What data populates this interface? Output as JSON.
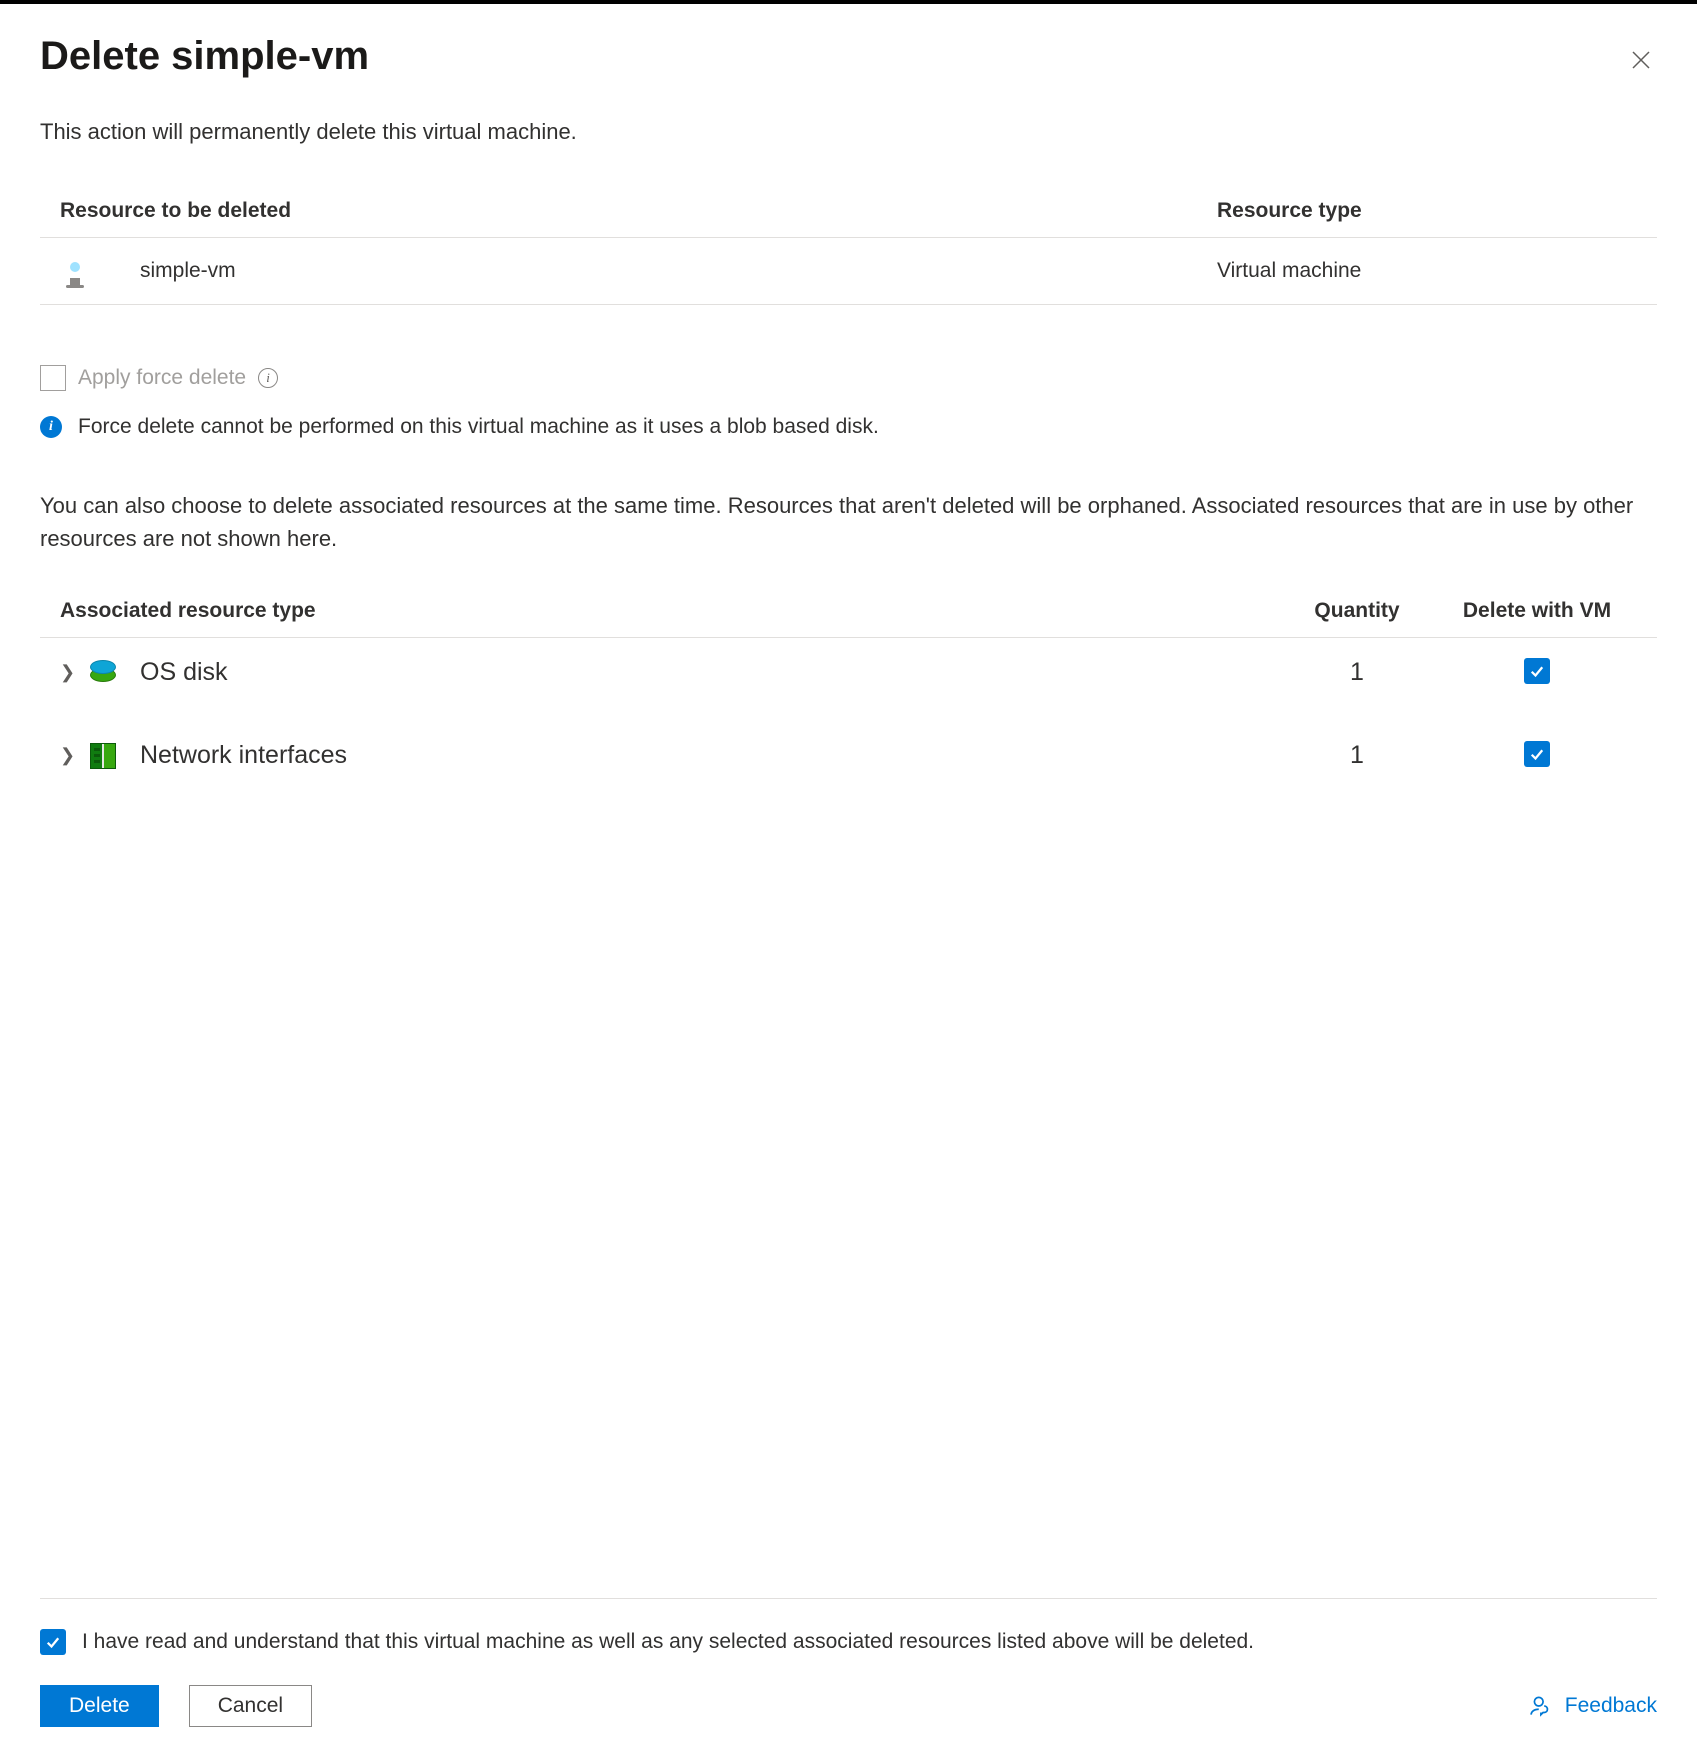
{
  "header": {
    "title": "Delete simple-vm"
  },
  "lead": "This action will permanently delete this virtual machine.",
  "resourceTable": {
    "col1": "Resource to be deleted",
    "col2": "Resource type",
    "row": {
      "name": "simple-vm",
      "type": "Virtual machine"
    }
  },
  "forceDelete": {
    "label": "Apply force delete",
    "info": "Force delete cannot be performed on this virtual machine as it uses a blob based disk."
  },
  "assocLead": "You can also choose to delete associated resources at the same time. Resources that aren't deleted will be orphaned. Associated resources that are in use by other resources are not shown here.",
  "assocTable": {
    "col1": "Associated resource type",
    "col2": "Quantity",
    "col3": "Delete with VM",
    "rows": [
      {
        "label": "OS disk",
        "qty": "1",
        "checked": true,
        "icon": "disk"
      },
      {
        "label": "Network interfaces",
        "qty": "1",
        "checked": true,
        "icon": "nic"
      }
    ]
  },
  "ack": "I have read and understand that this virtual machine as well as any selected associated resources listed above will be deleted.",
  "buttons": {
    "delete": "Delete",
    "cancel": "Cancel",
    "feedback": "Feedback"
  }
}
